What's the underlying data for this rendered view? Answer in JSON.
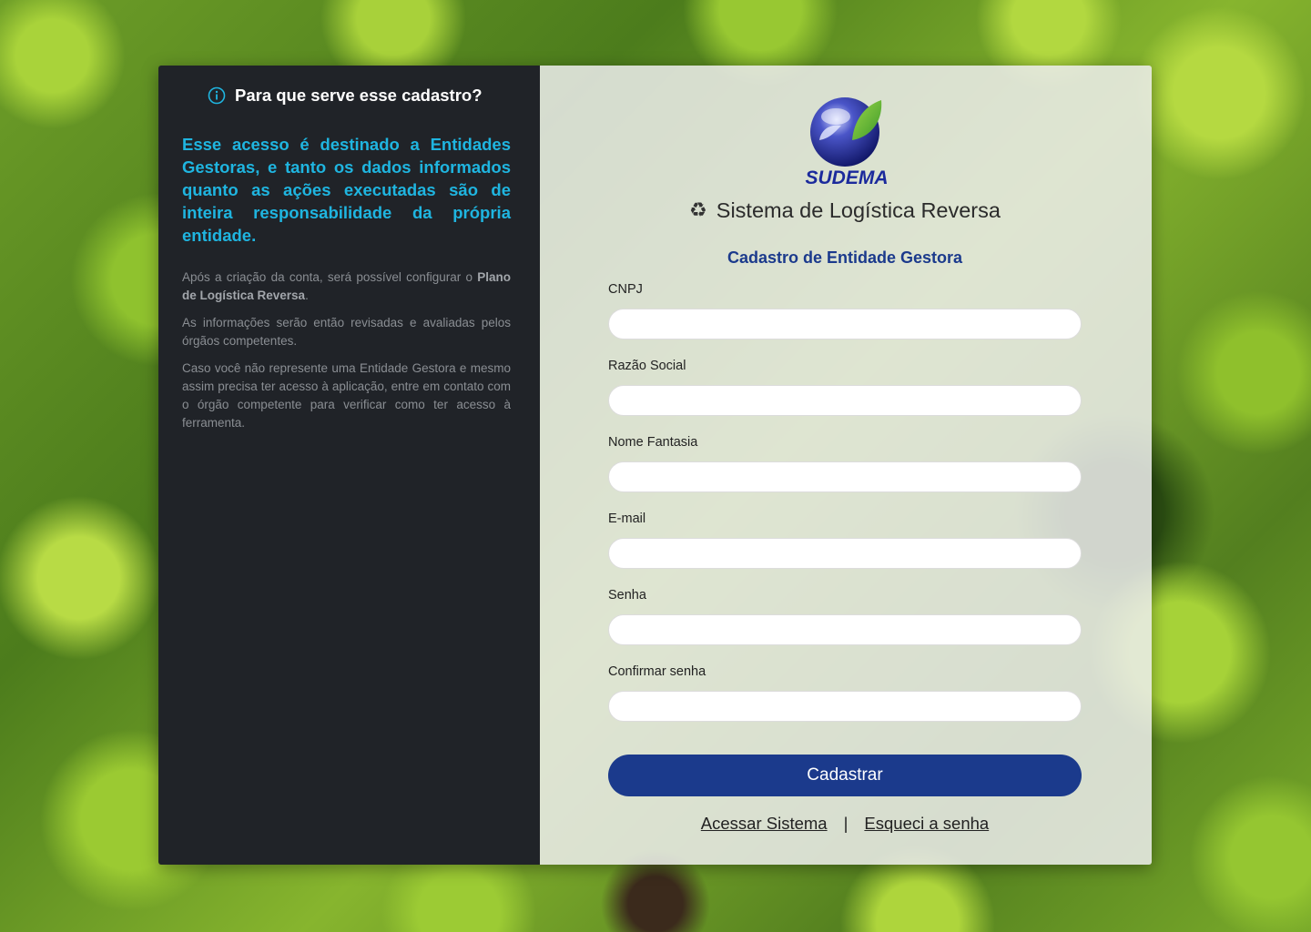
{
  "info": {
    "title": "Para que serve esse cadastro?",
    "lead": "Esse acesso é destinado a Entidades Gestoras, e tanto os dados informados quanto as ações executadas são de inteira responsabilidade da própria entidade.",
    "p1_before": "Após a criação da conta, será possível configurar o ",
    "p1_bold": "Plano de Logística Reversa",
    "p1_after": ".",
    "p2": "As informações serão então revisadas e avaliadas pelos órgãos competentes.",
    "p3": "Caso você não represente uma Entidade Gestora e mesmo assim precisa ter acesso à aplicação, entre em contato com o órgão competente para verificar como ter acesso à ferramenta."
  },
  "brand": {
    "logo_text": "SUDEMA",
    "app_title": "Sistema de Logística Reversa",
    "recycle_icon": "recycle-icon"
  },
  "form": {
    "subtitle": "Cadastro de Entidade Gestora",
    "fields": [
      {
        "label": "CNPJ",
        "value": ""
      },
      {
        "label": "Razão Social",
        "value": ""
      },
      {
        "label": "Nome Fantasia",
        "value": ""
      },
      {
        "label": "E-mail",
        "value": ""
      },
      {
        "label": "Senha",
        "value": ""
      },
      {
        "label": "Confirmar senha",
        "value": ""
      }
    ],
    "submit_label": "Cadastrar"
  },
  "links": {
    "login": "Acessar Sistema",
    "separator": "|",
    "forgot": "Esqueci a senha"
  },
  "colors": {
    "primary": "#1b3a8c",
    "accent": "#1fb5e0",
    "panel_dark": "#202328"
  }
}
